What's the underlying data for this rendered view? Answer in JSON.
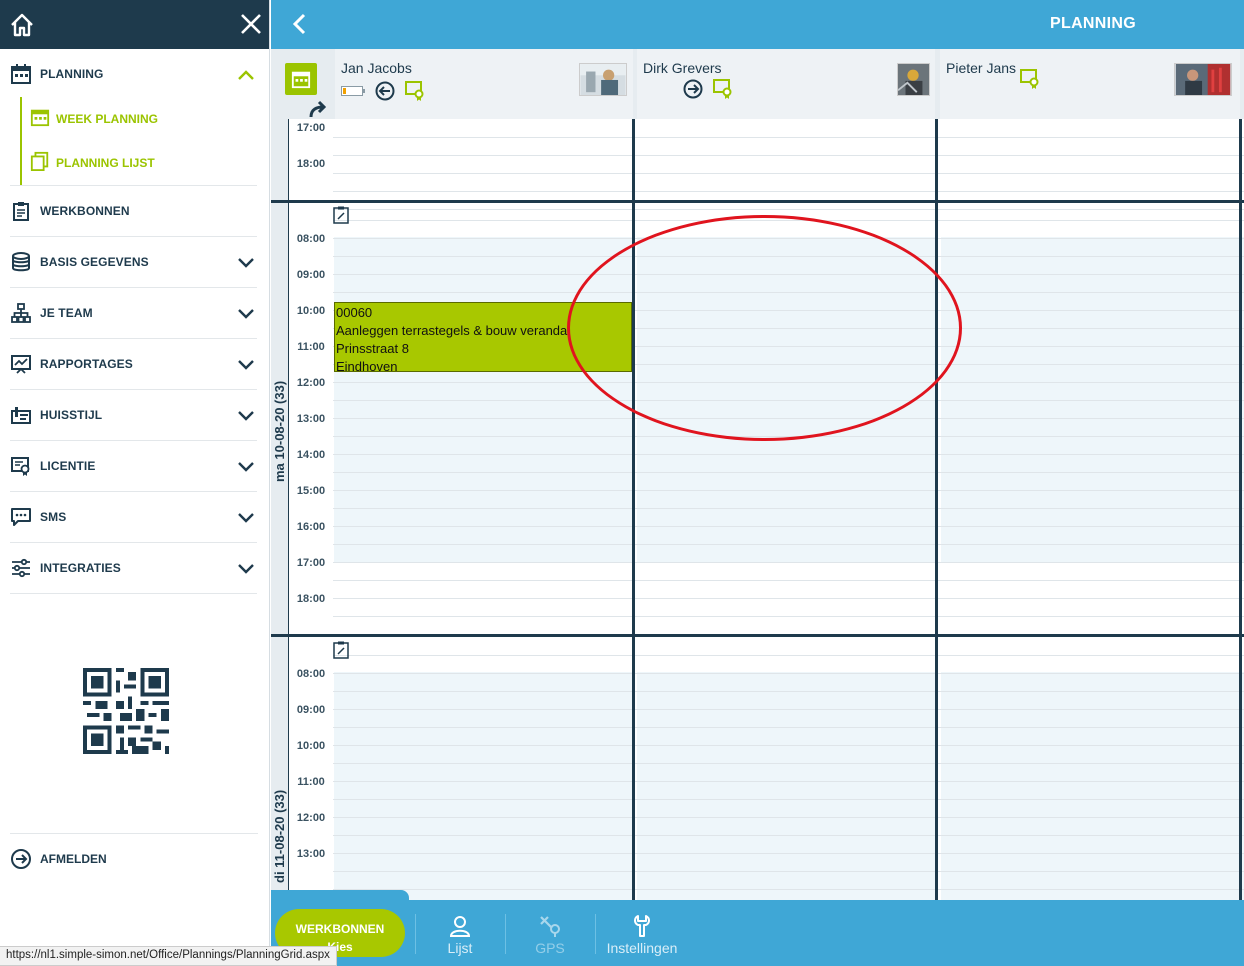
{
  "sidebar": {
    "items": [
      {
        "label": "PLANNING",
        "icon": "calendar-icon"
      },
      {
        "label": "WEEK PLANNING",
        "icon": "calendar-week-icon"
      },
      {
        "label": "PLANNING LIJST",
        "icon": "copy-list-icon"
      },
      {
        "label": "WERKBONNEN",
        "icon": "clipboard-icon"
      },
      {
        "label": "BASIS GEGEVENS",
        "icon": "database-icon"
      },
      {
        "label": "JE TEAM",
        "icon": "org-chart-icon"
      },
      {
        "label": "RAPPORTAGES",
        "icon": "report-icon"
      },
      {
        "label": "HUISSTIJL",
        "icon": "brand-icon"
      },
      {
        "label": "LICENTIE",
        "icon": "license-icon"
      },
      {
        "label": "SMS",
        "icon": "chat-icon"
      },
      {
        "label": "INTEGRATIES",
        "icon": "sliders-icon"
      }
    ],
    "logout_label": "AFMELDEN"
  },
  "status_url": "https://nl1.simple-simon.net/Office/Plannings/PlanningGrid.aspx",
  "header": {
    "title": "PLANNING"
  },
  "resources": [
    {
      "name": "Jan Jacobs"
    },
    {
      "name": "Dirk Grevers"
    },
    {
      "name": "Pieter Jans"
    }
  ],
  "days": [
    {
      "label": "ma 10-08-20 (33)"
    },
    {
      "label": "di 11-08-20 (33)"
    }
  ],
  "hours_prev_day": [
    "17:00",
    "18:00"
  ],
  "hours_day1": [
    "08:00",
    "09:00",
    "10:00",
    "11:00",
    "12:00",
    "13:00",
    "14:00",
    "15:00",
    "16:00",
    "17:00",
    "18:00"
  ],
  "hours_day2": [
    "08:00",
    "09:00",
    "10:00",
    "11:00",
    "12:00",
    "13:00"
  ],
  "event": {
    "number": "00060",
    "description": "Aanleggen terrastegels & bouw veranda",
    "street": "Prinsstraat 8",
    "city": "Eindhoven"
  },
  "bottom": {
    "primary_line1": "WERKBONNEN",
    "primary_line2": "Kies",
    "tabs": [
      "Lijst",
      "GPS",
      "Instellingen"
    ]
  },
  "colors": {
    "navy": "#1e3a4c",
    "blue": "#3fa7d6",
    "green": "#9bc400",
    "annotation": "#e0141e"
  }
}
